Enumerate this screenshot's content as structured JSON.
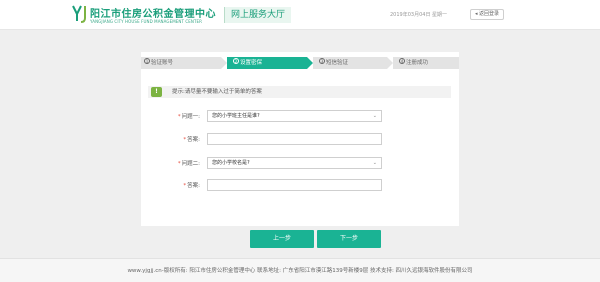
{
  "header": {
    "logo_icon": "yj-logo-mark",
    "logo_cn": "阳江市住房公积金管理中心",
    "logo_en": "YANGJIANG CITY HOUSE FUND MANAGEMENT CENTER",
    "hall_title": "网上服务大厅",
    "date": "2019年03月04日 星期一",
    "back_label": "返回登录",
    "brand_color": "#1a9e7a"
  },
  "steps": [
    {
      "number": "1",
      "label": "验证账号",
      "active": false
    },
    {
      "number": "2",
      "label": "设置密保",
      "active": true
    },
    {
      "number": "3",
      "label": "短信验证",
      "active": false
    },
    {
      "number": "4",
      "label": "注册成功",
      "active": false
    }
  ],
  "hint": {
    "icon": "exclamation-icon",
    "text": "提示:请尽量不要输入过于简单的答案"
  },
  "form": {
    "q1_label": "问题一:",
    "q1_value": "您的小学班主任是谁?",
    "a1_label": "答案:",
    "a1_value": "",
    "q2_label": "问题二:",
    "q2_value": "您的小学校名是?",
    "a2_label": "答案:",
    "a2_value": "",
    "required_mark": "*"
  },
  "buttons": {
    "prev": "上一步",
    "next": "下一步",
    "accent": "#1ab394"
  },
  "footer": {
    "text": "www.yjgjj.cn-版权所有: 阳江市住房公积金管理中心 联系地址: 广东省阳江市漠江路139号新楼9层 技术支持: 四川久远银海软件股份有限公司"
  }
}
